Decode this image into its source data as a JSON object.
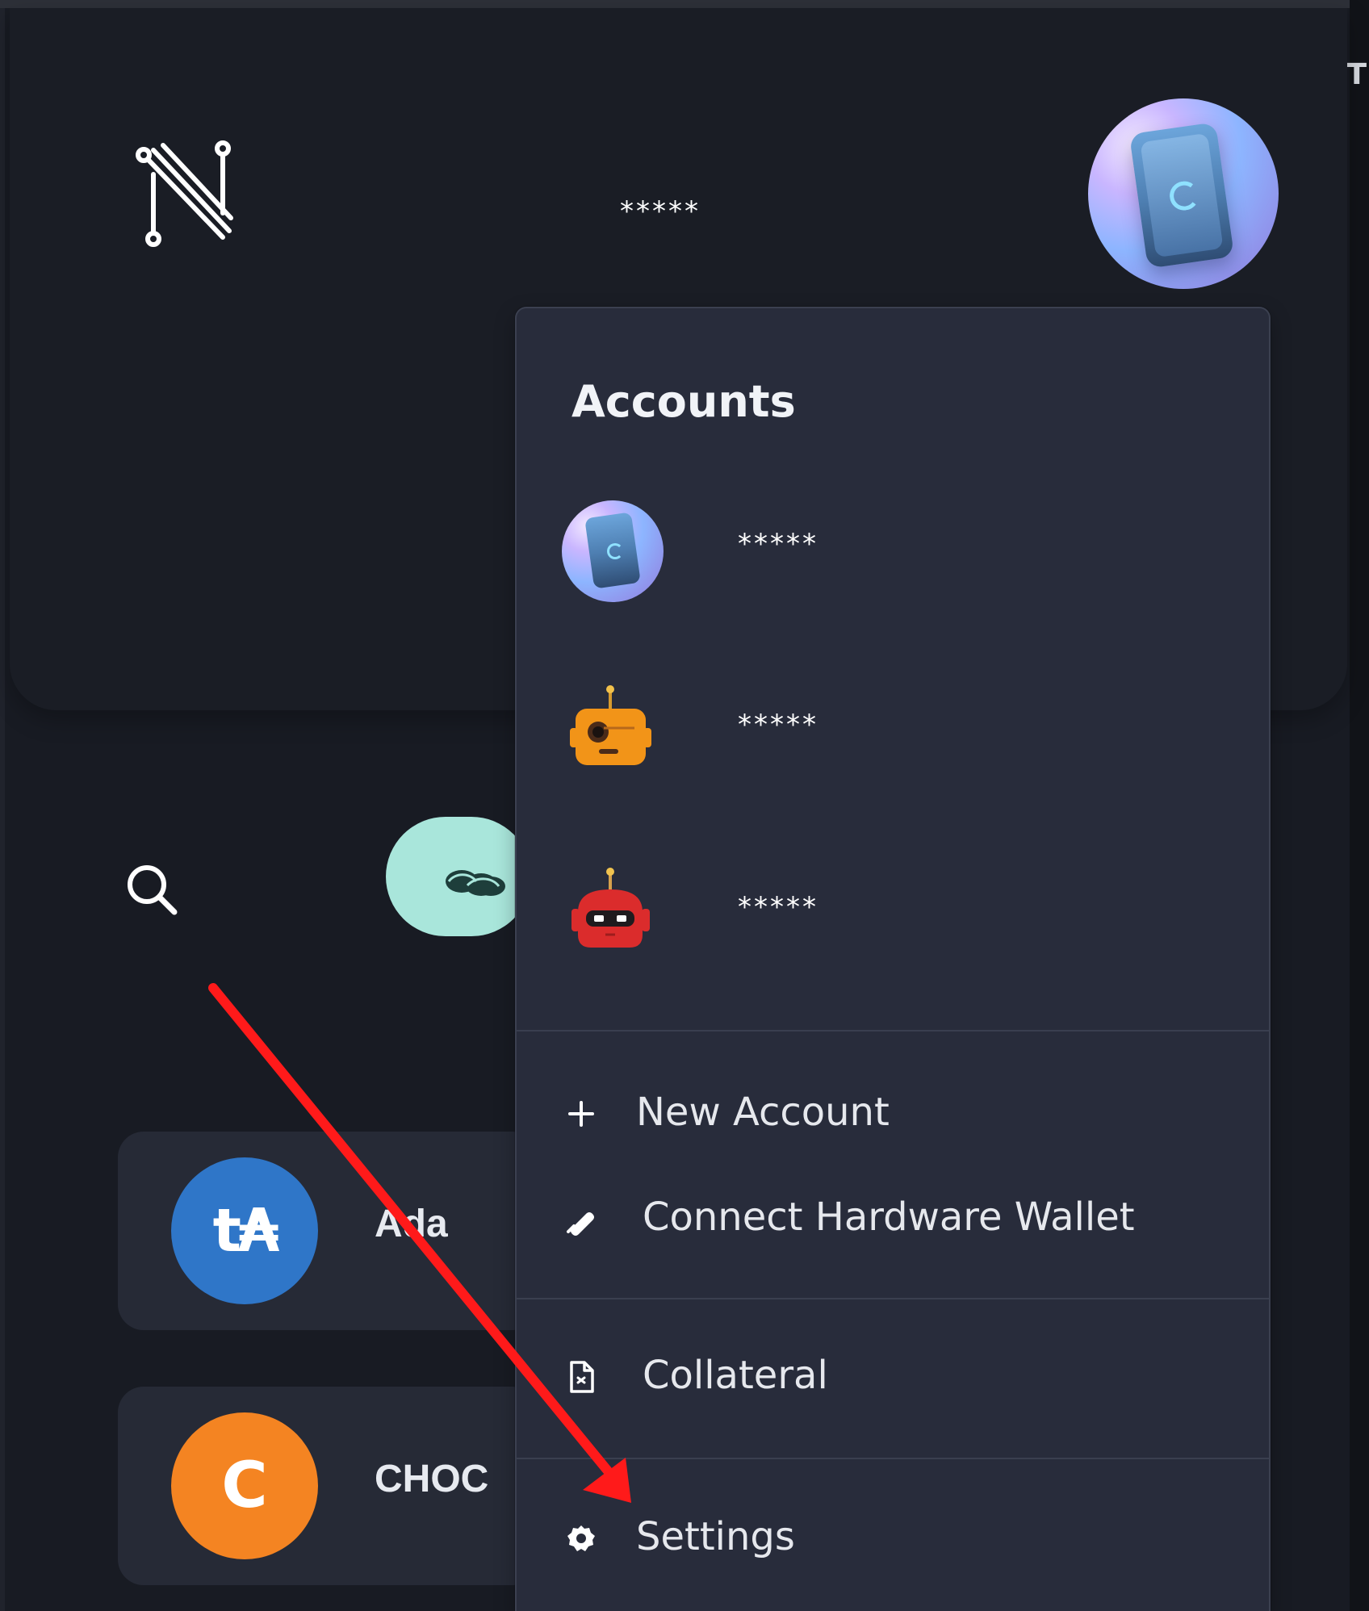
{
  "header": {
    "masked_name": "*****"
  },
  "side_edge": {
    "text": "ST"
  },
  "accounts_menu": {
    "title": "Accounts",
    "accounts": [
      {
        "name": "*****",
        "avatar": "phone-avatar"
      },
      {
        "name": "*****",
        "avatar": "orange-robot-avatar"
      },
      {
        "name": "*****",
        "avatar": "red-robot-avatar"
      }
    ],
    "items": {
      "new_account": "New Account",
      "connect_hardware_wallet": "Connect Hardware Wallet",
      "collateral": "Collateral",
      "settings": "Settings"
    }
  },
  "assets": [
    {
      "symbol_text": "t₳",
      "name": "Ada",
      "color": "#2f76c8"
    },
    {
      "symbol_text": "C",
      "name": "CHOC",
      "color": "#f48422"
    }
  ],
  "colors": {
    "background": "#181b23",
    "dropdown": "#282c3b",
    "teal_button": "#a9e6db",
    "annotation_arrow": "#ff1a1a"
  }
}
